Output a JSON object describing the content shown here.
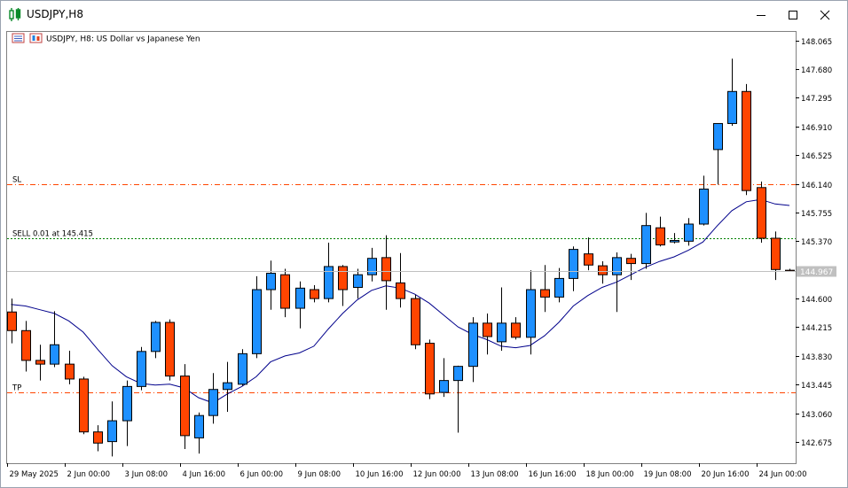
{
  "window": {
    "title": "USDJPY,H8"
  },
  "chart_header": {
    "text": "USDJPY, H8:  US Dollar vs Japanese Yen"
  },
  "colors": {
    "bull": "#1e90ff",
    "bear": "#ff4500",
    "ma": "#00008b",
    "level": "#ff4500",
    "entry": "#008000",
    "bid": "#c0c0c0"
  },
  "chart_data": {
    "type": "candlestick",
    "symbol": "USDJPY",
    "timeframe": "H8",
    "ylim": [
      142.39,
      148.18
    ],
    "y_ticks": [
      "148.065",
      "147.680",
      "147.295",
      "146.910",
      "146.525",
      "146.140",
      "145.755",
      "145.370",
      "144.985",
      "144.600",
      "144.215",
      "143.830",
      "143.445",
      "143.060",
      "142.675"
    ],
    "x_ticks": [
      "29 May 2025",
      "2 Jun 00:00",
      "3 Jun 08:00",
      "4 Jun 16:00",
      "6 Jun 00:00",
      "9 Jun 08:00",
      "10 Jun 16:00",
      "12 Jun 00:00",
      "13 Jun 08:00",
      "16 Jun 16:00",
      "18 Jun 00:00",
      "19 Jun 08:00",
      "20 Jun 16:00",
      "24 Jun 00:00"
    ],
    "candles": [
      {
        "o": 144.42,
        "h": 144.6,
        "l": 144.0,
        "c": 144.17
      },
      {
        "o": 144.17,
        "h": 144.3,
        "l": 143.62,
        "c": 143.77
      },
      {
        "o": 143.77,
        "h": 143.98,
        "l": 143.5,
        "c": 143.72
      },
      {
        "o": 143.72,
        "h": 144.43,
        "l": 143.68,
        "c": 143.98
      },
      {
        "o": 143.72,
        "h": 143.9,
        "l": 143.45,
        "c": 143.52
      },
      {
        "o": 143.52,
        "h": 143.55,
        "l": 142.78,
        "c": 142.81
      },
      {
        "o": 142.81,
        "h": 142.9,
        "l": 142.55,
        "c": 142.66
      },
      {
        "o": 142.68,
        "h": 143.22,
        "l": 142.48,
        "c": 142.96
      },
      {
        "o": 142.96,
        "h": 143.5,
        "l": 142.62,
        "c": 143.42
      },
      {
        "o": 143.42,
        "h": 143.95,
        "l": 143.37,
        "c": 143.89
      },
      {
        "o": 143.89,
        "h": 144.3,
        "l": 143.8,
        "c": 144.28
      },
      {
        "o": 144.28,
        "h": 144.32,
        "l": 143.5,
        "c": 143.56
      },
      {
        "o": 143.56,
        "h": 143.72,
        "l": 142.58,
        "c": 142.76
      },
      {
        "o": 142.73,
        "h": 143.07,
        "l": 142.52,
        "c": 143.03
      },
      {
        "o": 143.03,
        "h": 143.6,
        "l": 142.92,
        "c": 143.38
      },
      {
        "o": 143.38,
        "h": 143.75,
        "l": 143.08,
        "c": 143.47
      },
      {
        "o": 143.45,
        "h": 143.92,
        "l": 143.43,
        "c": 143.86
      },
      {
        "o": 143.86,
        "h": 144.9,
        "l": 143.8,
        "c": 144.72
      },
      {
        "o": 144.72,
        "h": 145.11,
        "l": 144.45,
        "c": 144.94
      },
      {
        "o": 144.92,
        "h": 145.0,
        "l": 144.35,
        "c": 144.47
      },
      {
        "o": 144.47,
        "h": 144.83,
        "l": 144.2,
        "c": 144.74
      },
      {
        "o": 144.72,
        "h": 144.78,
        "l": 144.55,
        "c": 144.6
      },
      {
        "o": 144.6,
        "h": 145.35,
        "l": 144.55,
        "c": 145.03
      },
      {
        "o": 145.03,
        "h": 145.05,
        "l": 144.5,
        "c": 144.72
      },
      {
        "o": 144.75,
        "h": 145.0,
        "l": 144.6,
        "c": 144.92
      },
      {
        "o": 144.92,
        "h": 145.28,
        "l": 144.83,
        "c": 145.14
      },
      {
        "o": 145.15,
        "h": 145.45,
        "l": 144.45,
        "c": 144.84
      },
      {
        "o": 144.81,
        "h": 145.21,
        "l": 144.48,
        "c": 144.6
      },
      {
        "o": 144.6,
        "h": 144.65,
        "l": 143.92,
        "c": 143.98
      },
      {
        "o": 144.0,
        "h": 144.05,
        "l": 143.25,
        "c": 143.32
      },
      {
        "o": 143.34,
        "h": 143.8,
        "l": 143.28,
        "c": 143.5
      },
      {
        "o": 143.5,
        "h": 143.7,
        "l": 142.8,
        "c": 143.69
      },
      {
        "o": 143.69,
        "h": 144.35,
        "l": 143.48,
        "c": 144.27
      },
      {
        "o": 144.27,
        "h": 144.4,
        "l": 143.85,
        "c": 144.09
      },
      {
        "o": 144.02,
        "h": 144.75,
        "l": 143.9,
        "c": 144.27
      },
      {
        "o": 144.27,
        "h": 144.35,
        "l": 144.05,
        "c": 144.08
      },
      {
        "o": 144.08,
        "h": 144.98,
        "l": 143.85,
        "c": 144.72
      },
      {
        "o": 144.72,
        "h": 145.05,
        "l": 144.42,
        "c": 144.62
      },
      {
        "o": 144.62,
        "h": 145.01,
        "l": 144.55,
        "c": 144.87
      },
      {
        "o": 144.87,
        "h": 145.3,
        "l": 144.7,
        "c": 145.26
      },
      {
        "o": 145.2,
        "h": 145.42,
        "l": 144.98,
        "c": 145.05
      },
      {
        "o": 145.04,
        "h": 145.1,
        "l": 144.8,
        "c": 144.92
      },
      {
        "o": 144.92,
        "h": 145.22,
        "l": 144.42,
        "c": 145.15
      },
      {
        "o": 145.14,
        "h": 145.2,
        "l": 144.85,
        "c": 145.07
      },
      {
        "o": 145.07,
        "h": 145.75,
        "l": 145.0,
        "c": 145.58
      },
      {
        "o": 145.55,
        "h": 145.7,
        "l": 145.3,
        "c": 145.32
      },
      {
        "o": 145.36,
        "h": 145.48,
        "l": 145.34,
        "c": 145.38
      },
      {
        "o": 145.37,
        "h": 145.68,
        "l": 145.31,
        "c": 145.6
      },
      {
        "o": 145.6,
        "h": 146.25,
        "l": 145.58,
        "c": 146.07
      },
      {
        "o": 146.6,
        "h": 146.95,
        "l": 146.13,
        "c": 146.95
      },
      {
        "o": 146.95,
        "h": 147.82,
        "l": 146.92,
        "c": 147.38
      },
      {
        "o": 147.38,
        "h": 147.48,
        "l": 145.99,
        "c": 146.05
      },
      {
        "o": 146.09,
        "h": 146.17,
        "l": 145.35,
        "c": 145.41
      },
      {
        "o": 145.41,
        "h": 145.5,
        "l": 144.85,
        "c": 144.99
      },
      {
        "o": 144.98,
        "h": 145.0,
        "l": 144.96,
        "c": 144.967
      }
    ],
    "moving_average": [
      144.52,
      144.5,
      144.45,
      144.4,
      144.3,
      144.15,
      143.92,
      143.7,
      143.55,
      143.46,
      143.44,
      143.45,
      143.4,
      143.27,
      143.2,
      143.32,
      143.42,
      143.55,
      143.75,
      143.83,
      143.87,
      143.96,
      144.19,
      144.4,
      144.58,
      144.71,
      144.77,
      144.74,
      144.66,
      144.54,
      144.38,
      144.22,
      144.12,
      144.05,
      143.96,
      143.94,
      143.97,
      144.1,
      144.28,
      144.5,
      144.64,
      144.75,
      144.82,
      144.92,
      145.02,
      145.1,
      145.16,
      145.25,
      145.36,
      145.58,
      145.78,
      145.9,
      145.93,
      145.87,
      145.85
    ],
    "levels": [
      {
        "label": "SL",
        "price": 146.14
      },
      {
        "label": "SELL 0.01 at 145.415",
        "price": 145.415
      },
      {
        "label": "TP",
        "price": 143.342
      }
    ],
    "bid": "144.967"
  }
}
